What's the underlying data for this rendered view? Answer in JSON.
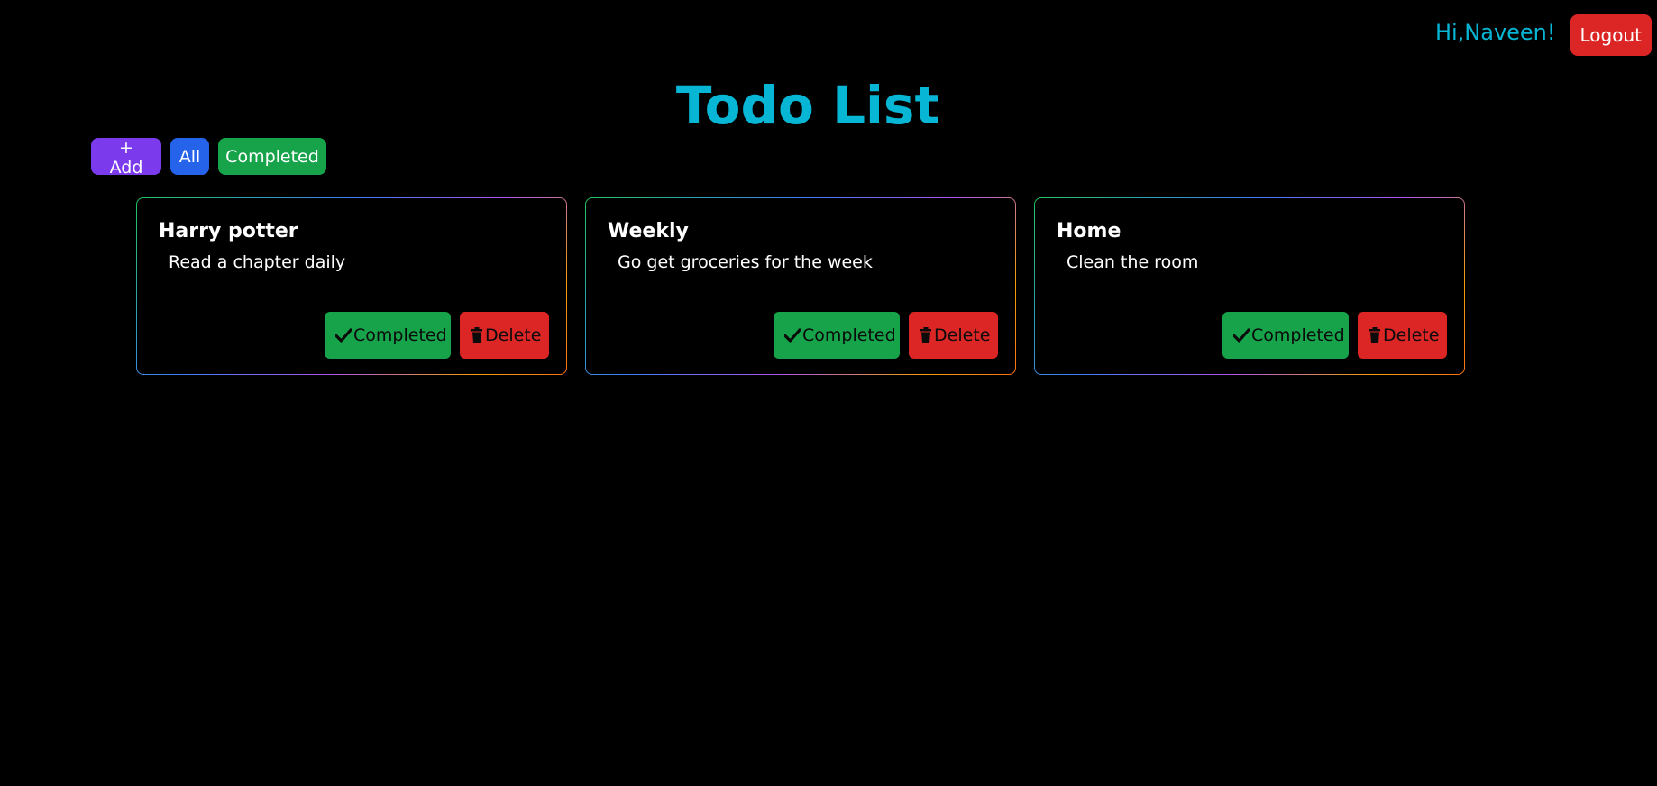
{
  "header": {
    "greeting": "Hi,Naveen!",
    "logout_label": "Logout"
  },
  "page_title": "Todo List",
  "filters": {
    "add_label": "+ Add",
    "all_label": "All",
    "completed_label": "Completed"
  },
  "todos": [
    {
      "title": "Harry potter",
      "description": "Read a chapter daily",
      "complete_label": "Completed",
      "delete_label": "Delete"
    },
    {
      "title": "Weekly",
      "description": "Go get groceries for the week",
      "complete_label": "Completed",
      "delete_label": "Delete"
    },
    {
      "title": "Home",
      "description": "Clean the room",
      "complete_label": "Completed",
      "delete_label": "Delete"
    }
  ],
  "icons": {
    "complete": "check-icon",
    "delete": "trash-icon"
  },
  "colors": {
    "background": "#000000",
    "accent": "#06b6d4",
    "add": "#7c3aed",
    "all": "#2563eb",
    "completed": "#16a34a",
    "danger": "#dc2626"
  }
}
